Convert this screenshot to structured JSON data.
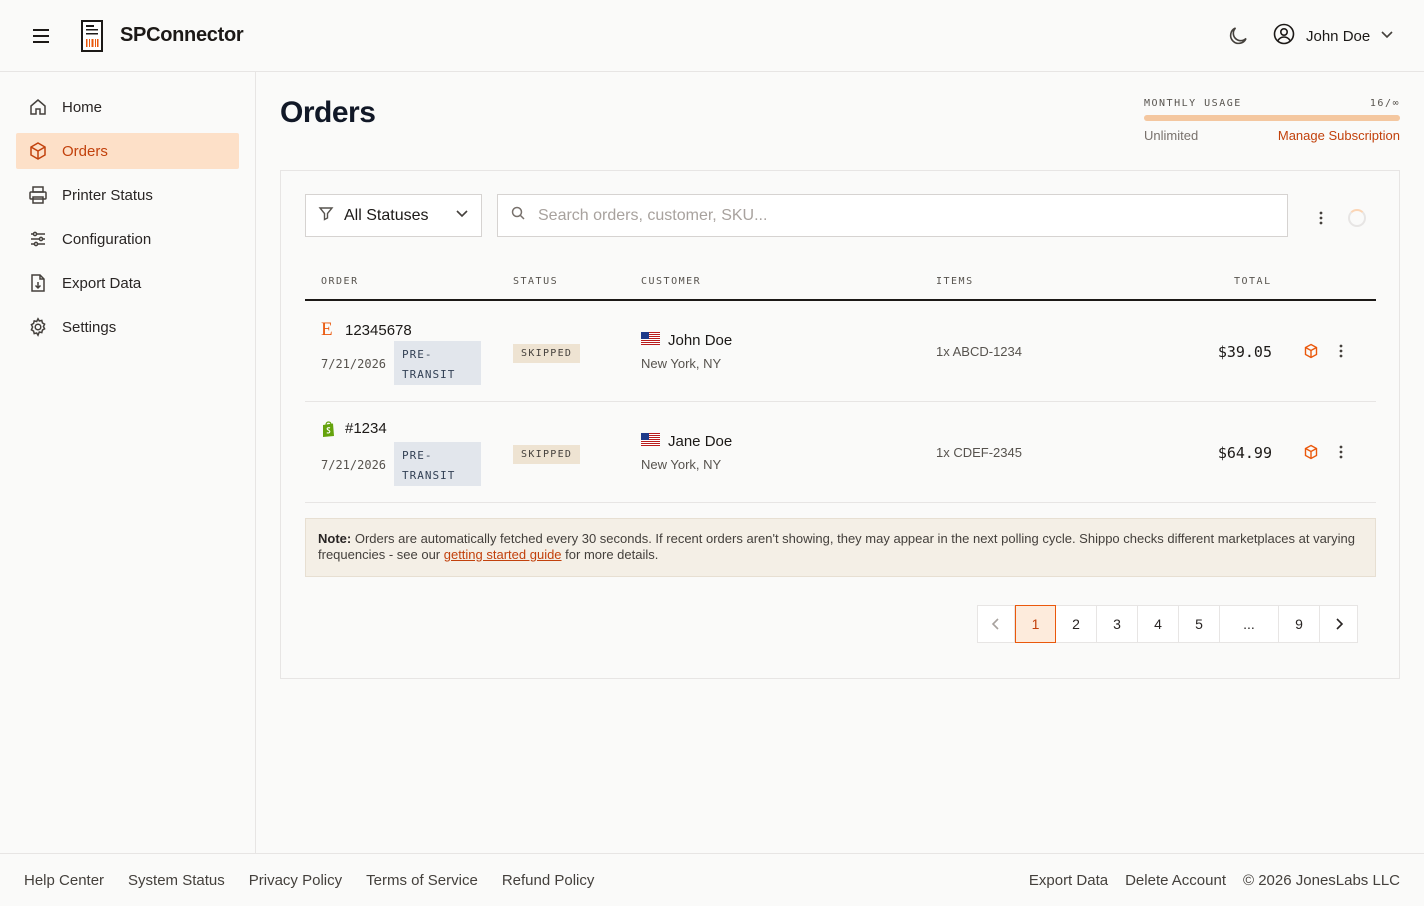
{
  "app": {
    "name": "SPConnector"
  },
  "header": {
    "user_name": "John Doe"
  },
  "sidebar": {
    "items": [
      {
        "label": "Home",
        "icon": "home-icon"
      },
      {
        "label": "Orders",
        "icon": "box-icon",
        "active": true
      },
      {
        "label": "Printer Status",
        "icon": "printer-icon"
      },
      {
        "label": "Configuration",
        "icon": "sliders-icon"
      },
      {
        "label": "Export Data",
        "icon": "file-export-icon"
      },
      {
        "label": "Settings",
        "icon": "gear-icon"
      }
    ]
  },
  "page": {
    "title": "Orders"
  },
  "usage": {
    "label": "MONTHLY USAGE",
    "count": "16/∞",
    "plan": "Unlimited",
    "manage_label": "Manage Subscription",
    "fill_fraction": 1.0
  },
  "filters": {
    "status_label": "All Statuses",
    "search_placeholder": "Search orders, customer, SKU..."
  },
  "table": {
    "headers": {
      "order": "ORDER",
      "status": "STATUS",
      "customer": "CUSTOMER",
      "items": "ITEMS",
      "total": "TOTAL"
    },
    "rows": [
      {
        "marketplace": "etsy-icon",
        "marketplace_letter": "E",
        "order_id": "12345678",
        "date": "7/21/2026",
        "tracking_badge_1": "PRE-",
        "tracking_badge_2": "TRANSIT",
        "status": "SKIPPED",
        "customer_name": "John Doe",
        "customer_location": "New York, NY",
        "items": "1x ABCD-1234",
        "total": "$39.05"
      },
      {
        "marketplace": "shopify-icon",
        "order_id": "#1234",
        "date": "7/21/2026",
        "tracking_badge_1": "PRE-",
        "tracking_badge_2": "TRANSIT",
        "status": "SKIPPED",
        "customer_name": "Jane Doe",
        "customer_location": "New York, NY",
        "items": "1x CDEF-2345",
        "total": "$64.99"
      }
    ]
  },
  "note": {
    "prefix": "Note:",
    "text_before": " Orders are automatically fetched every 30 seconds. If recent orders aren't showing, they may appear in the next polling cycle. Shippo checks different marketplaces at varying frequencies - see our ",
    "link": "getting started guide",
    "text_after": " for more details."
  },
  "pagination": {
    "pages": [
      "1",
      "2",
      "3",
      "4",
      "5",
      "...",
      "9"
    ],
    "current": "1"
  },
  "footer": {
    "left": [
      "Help Center",
      "System Status",
      "Privacy Policy",
      "Terms of Service",
      "Refund Policy"
    ],
    "export_label": "Export Data",
    "delete_label": "Delete Account",
    "copyright": "© 2026 JonesLabs LLC"
  },
  "colors": {
    "accent": "#ea580c",
    "accent_light": "#fde0c8",
    "badge": "#eee3d2",
    "pre_transit": "#e2e6ec"
  }
}
